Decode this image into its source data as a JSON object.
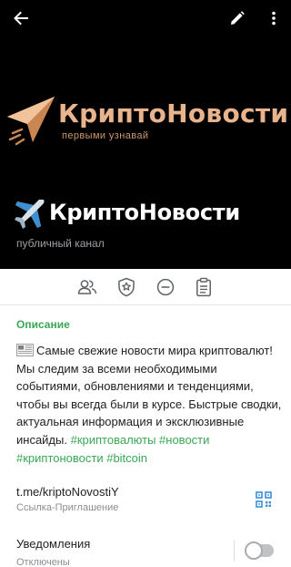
{
  "logo": {
    "title": "КриптоНовости",
    "subtitle": "первыми узнавай"
  },
  "channel": {
    "name": "КриптоНовости",
    "type_label": "публичный канал",
    "icon": "airplane-emoji"
  },
  "topbar": {
    "icons": [
      "back-arrow-icon",
      "pencil-edit-icon",
      "more-vertical-icon"
    ]
  },
  "actions": {
    "icons": [
      "members-icon",
      "admins-shield-icon",
      "remove-circle-icon",
      "recent-actions-clipboard-icon"
    ]
  },
  "description": {
    "label": "Описание",
    "icon": "newspaper-emoji",
    "text": "Самые свежие новости мира криптовалют! Мы следим за всеми необходимыми событиями, обновлениями и тенденциями, чтобы вы всегда были в курсе. Быстрые сводки, актуальная информация и эксклюзивные инсайды.",
    "hashtags": "#криптовалюты #новости #криптоновости #bitcoin"
  },
  "invite_link": {
    "url": "t.me/kriptoNovostiY",
    "label": "Ссылка-Приглашение"
  },
  "notifications": {
    "label": "Уведомления",
    "status": "Отключены",
    "enabled": false
  },
  "colors": {
    "accent_green": "#3aa757",
    "logo_gold": "#e9b48c",
    "header_bg": "#000000"
  }
}
